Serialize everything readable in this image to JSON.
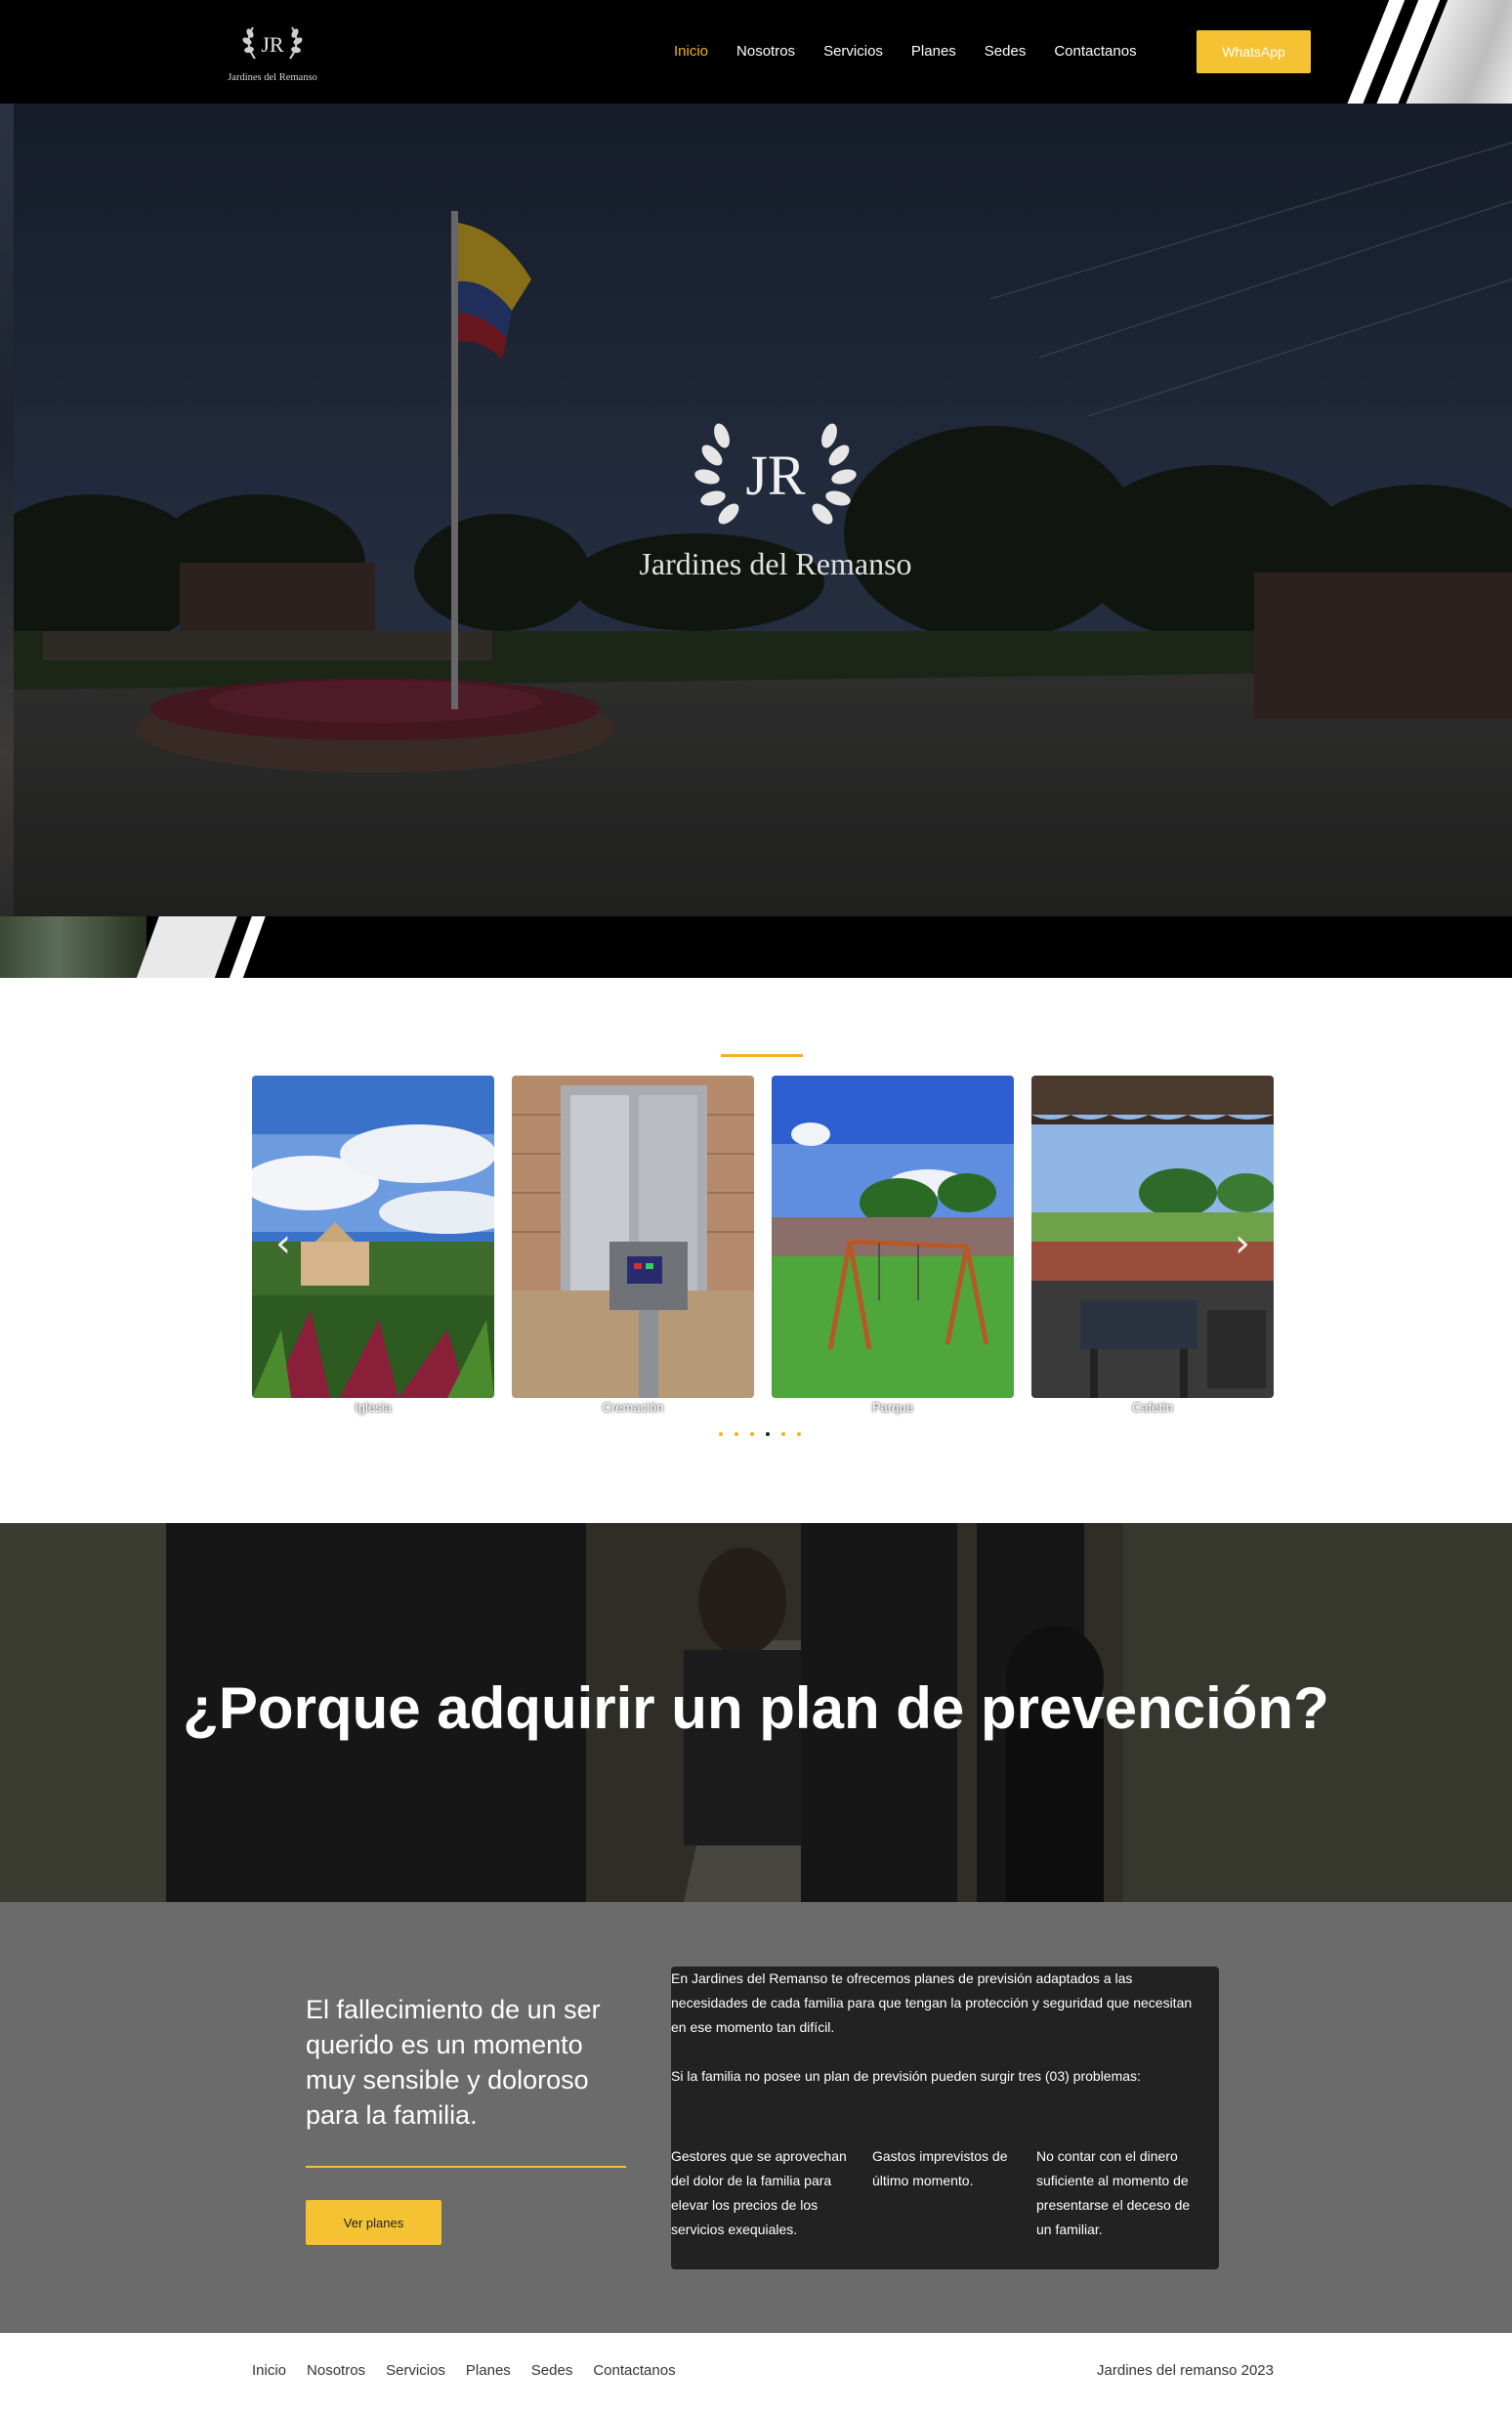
{
  "brand": {
    "logo_monogram": "JR",
    "logo_text": "Jardines del Remanso",
    "accent": "#f5b31b",
    "button_color": "#f5c233"
  },
  "nav": {
    "items": [
      "Inicio",
      "Nosotros",
      "Servicios",
      "Planes",
      "Sedes",
      "Contactanos"
    ],
    "active": "Inicio",
    "whatsapp_label": "WhatsApp"
  },
  "hero": {
    "logo_monogram": "JR",
    "logo_text": "Jardines del Remanso"
  },
  "gallery": {
    "cards": [
      {
        "caption": "Iglesia",
        "image": "church"
      },
      {
        "caption": "Cremación",
        "image": "cremation"
      },
      {
        "caption": "Parque",
        "image": "park"
      },
      {
        "caption": "Cafetín",
        "image": "cafe"
      }
    ],
    "prev_icon": "chevron-left-icon",
    "next_icon": "chevron-right-icon",
    "dot_count": 6,
    "active_dot": 3
  },
  "banner": {
    "title": "¿Porque adquirir un plan de prevención?"
  },
  "info": {
    "heading": "El fallecimiento de un ser querido es un momento muy sensible y doloroso para la familia.",
    "button_label": "Ver planes",
    "paragraph1": "En Jardines del Remanso te ofrecemos planes de previsión adaptados a las necesidades de cada familia para que tengan la protección y seguridad que necesitan en ese momento tan difícil.",
    "paragraph2": "Si la familia no posee un plan de previsión pueden surgir tres (03) problemas:",
    "problems": [
      "Gestores que se aprovechan del dolor de la familia para elevar los precios de los servicios exequiales.",
      "Gastos imprevistos de último momento.",
      "No contar con el dinero suficiente al momento de presentarse el deceso de un familiar."
    ]
  },
  "footer": {
    "items": [
      "Inicio",
      "Nosotros",
      "Servicios",
      "Planes",
      "Sedes",
      "Contactanos"
    ],
    "copyright": "Jardines del remanso 2023"
  }
}
